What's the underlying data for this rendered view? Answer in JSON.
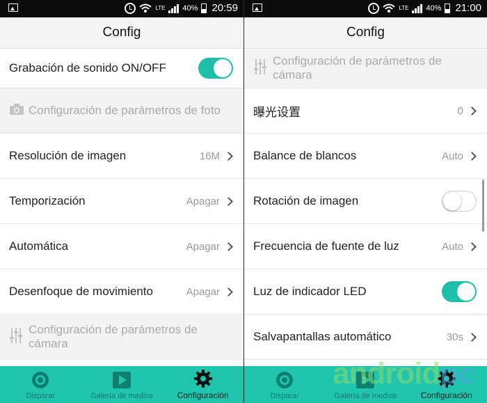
{
  "left": {
    "status": {
      "network": "LTE",
      "battery": "40%",
      "time": "20:59"
    },
    "title": "Config",
    "rows": {
      "sound": {
        "label": "Grabación de sonido ON/OFF"
      },
      "photo_section": {
        "label": "Configuración de parámetros de foto"
      },
      "resolution": {
        "label": "Resolución de imagen",
        "value": "16M"
      },
      "timer": {
        "label": "Temporización",
        "value": "Apagar"
      },
      "auto": {
        "label": "Automática",
        "value": "Apagar"
      },
      "blur": {
        "label": "Desenfoque de movimiento",
        "value": "Apagar"
      },
      "camera_section": {
        "label": "Configuración de parámetros de cámara"
      }
    },
    "nav": [
      "Disparar",
      "Galería de medios",
      "Configuración"
    ]
  },
  "right": {
    "status": {
      "network": "LTE",
      "battery": "40%",
      "time": "21:00"
    },
    "title": "Config",
    "rows": {
      "camera_section": {
        "label": "Configuración de parámetros de cámara"
      },
      "exposure": {
        "label": "曝光设置",
        "value": "0"
      },
      "white_balance": {
        "label": "Balance de blancos",
        "value": "Auto"
      },
      "rotation": {
        "label": "Rotación de imagen"
      },
      "light_freq": {
        "label": "Frecuencia de fuente de luz",
        "value": "Auto"
      },
      "led": {
        "label": "Luz de indicador LED"
      },
      "screensaver": {
        "label": "Salvapantallas automático",
        "value": "30s"
      }
    },
    "nav": [
      "Disparar",
      "Galería de medios",
      "Configuración"
    ]
  },
  "watermark": {
    "text": "android",
    "suffix": "pc"
  },
  "colors": {
    "accent": "#21c4ad",
    "toggle_on": "#1dbfa8",
    "statusbar": "#0c0c0c"
  },
  "icons": {
    "status": [
      "image-icon",
      "alarm-icon",
      "wifi-icon",
      "signal-icon",
      "battery-icon"
    ],
    "nav": [
      "shutter-icon",
      "play-gallery-icon",
      "gear-icon"
    ]
  }
}
